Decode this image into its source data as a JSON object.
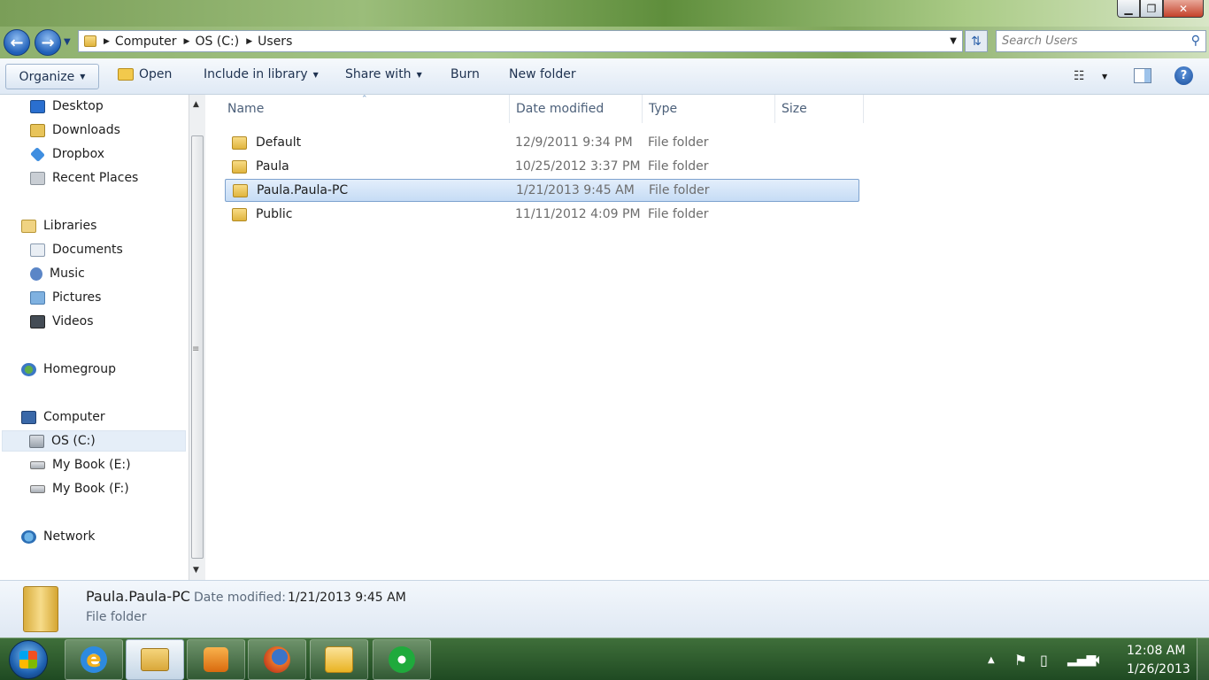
{
  "window": {
    "minimize_label": "▁",
    "maximize_label": "❐",
    "close_label": "✕"
  },
  "address": {
    "crumbs": [
      "Computer",
      "OS (C:)",
      "Users"
    ],
    "search_placeholder": "Search Users"
  },
  "toolbar": {
    "organize": "Organize",
    "open": "Open",
    "include_in_library": "Include in library",
    "share_with": "Share with",
    "burn": "Burn",
    "new_folder": "New folder",
    "help": "?"
  },
  "nav": {
    "favorites": [
      "Desktop",
      "Downloads",
      "Dropbox",
      "Recent Places"
    ],
    "libraries": "Libraries",
    "library_items": [
      "Documents",
      "Music",
      "Pictures",
      "Videos"
    ],
    "homegroup": "Homegroup",
    "computer": "Computer",
    "drives": [
      "OS (C:)",
      "My Book (E:)",
      "My Book (F:)"
    ],
    "network": "Network",
    "selected": "OS (C:)"
  },
  "columns": {
    "name": "Name",
    "date_modified": "Date modified",
    "type": "Type",
    "size": "Size"
  },
  "files": [
    {
      "name": "Default",
      "date": "12/9/2011 9:34 PM",
      "type": "File folder"
    },
    {
      "name": "Paula",
      "date": "10/25/2012 3:37 PM",
      "type": "File folder"
    },
    {
      "name": "Paula.Paula-PC",
      "date": "1/21/2013 9:45 AM",
      "type": "File folder",
      "selected": true
    },
    {
      "name": "Public",
      "date": "11/11/2012 4:09 PM",
      "type": "File folder"
    }
  ],
  "details": {
    "name": "Paula.Paula-PC",
    "date_label": "Date modified:",
    "date_value": "1/21/2013 9:45 AM",
    "type": "File folder"
  },
  "taskbar": {
    "clock_time": "12:08 AM",
    "clock_date": "1/26/2013"
  }
}
